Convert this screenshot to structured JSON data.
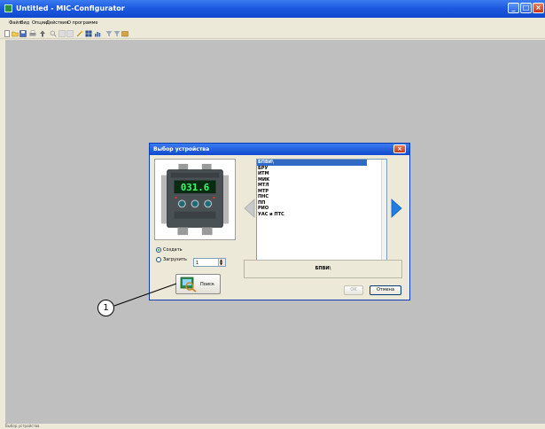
{
  "window": {
    "title": "Untitled - MIC-Configurator",
    "controls": {
      "minimize": "_",
      "maximize": "□",
      "close": "×"
    }
  },
  "menu": [
    "Файл",
    "Вид",
    "Опции",
    "Действия",
    "О программе"
  ],
  "toolbar": {
    "icons": [
      "new-file-icon",
      "open-folder-icon",
      "save-icon",
      "print-icon",
      "upload-icon",
      "search-icon",
      "cut-icon",
      "copy-icon",
      "wand-icon",
      "table-icon",
      "chart-icon",
      "filter-icon",
      "settings-icon",
      "device-icon"
    ]
  },
  "dialog": {
    "title": "Выбор устройства",
    "device_display": "031.6",
    "create_label": "Создать",
    "load_label": "Загрузить",
    "load_value": "1",
    "search_label": "Поиск",
    "devices": [
      "БПВИ\\",
      "БРУ",
      "ИТМ",
      "МИК",
      "МТЛ",
      "МТР",
      "ПНС",
      "ПП",
      "РИО",
      "УАС и ПТС"
    ],
    "selected_device": "БПВИ\\",
    "ok_label": "OK",
    "cancel_label": "Отмена"
  },
  "callout": {
    "number": "1"
  },
  "statusbar": {
    "text": "Выбор устройства"
  },
  "colors": {
    "titlebar": "#0f49cd",
    "workspace": "#bfbfbf",
    "selection": "#316ac5",
    "arrow": "#1e7fe0"
  }
}
